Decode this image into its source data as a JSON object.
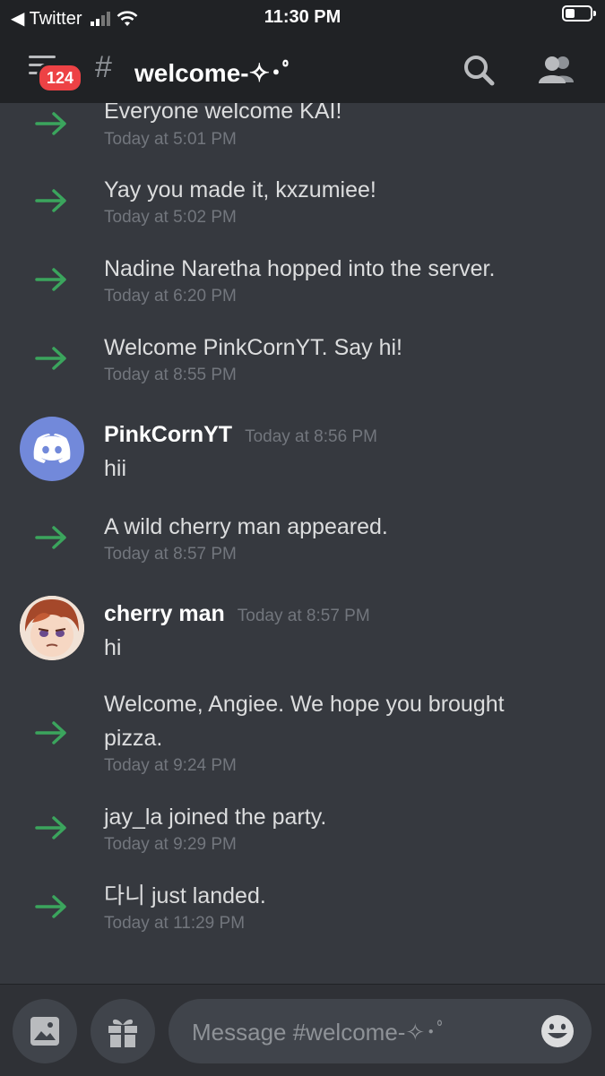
{
  "status_bar": {
    "back_app": "◀ Twitter",
    "time": "11:30 PM",
    "battery_level": 0.4
  },
  "header": {
    "badge_count": "124",
    "channel_name": "welcome-✧･ﾟ"
  },
  "colors": {
    "accent_green": "#3ba55d",
    "badge_red": "#ed4245",
    "blurple": "#7289da"
  },
  "messages": [
    {
      "type": "system",
      "text": "Everyone welcome KAI!",
      "time": "Today at 5:01 PM"
    },
    {
      "type": "system",
      "text": "Yay you made it, kxzumiee!",
      "time": "Today at 5:02 PM"
    },
    {
      "type": "system",
      "text": "Nadine Naretha hopped into the server.",
      "time": "Today at 6:20 PM"
    },
    {
      "type": "system",
      "text": "Welcome PinkCornYT. Say hi!",
      "time": "Today at 8:55 PM"
    },
    {
      "type": "user",
      "username": "PinkCornYT",
      "time": "Today at 8:56 PM",
      "text": "hii",
      "avatar": "discord-logo-icon"
    },
    {
      "type": "system",
      "text": "A wild cherry man appeared.",
      "time": "Today at 8:57 PM"
    },
    {
      "type": "user",
      "username": "cherry man",
      "time": "Today at 8:57 PM",
      "text": "hi",
      "avatar": "anime-character-avatar"
    },
    {
      "type": "system",
      "text": "Welcome, Angiee. We hope you brought pizza.",
      "time": "Today at 9:24 PM"
    },
    {
      "type": "system",
      "text": "jay_la joined the party.",
      "time": "Today at 9:29 PM"
    },
    {
      "type": "system",
      "text": "다니 just landed.",
      "time": "Today at 11:29 PM"
    }
  ],
  "composer": {
    "placeholder": "Message #welcome-✧･ﾟ"
  }
}
